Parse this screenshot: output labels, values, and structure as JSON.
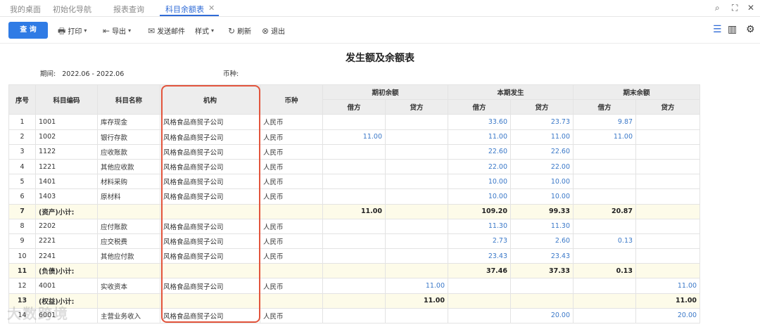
{
  "tabs": [
    {
      "label": "我的桌面"
    },
    {
      "label": "初始化导航"
    },
    {
      "label": "报表查询"
    },
    {
      "label": "科目余额表"
    }
  ],
  "toolbar": {
    "query_label": "查 询",
    "print_label": "打印",
    "export_label": "导出",
    "email_label": "发送邮件",
    "style_label": "样式",
    "refresh_label": "刷新",
    "exit_label": "退出"
  },
  "report": {
    "title": "发生额及余额表",
    "period_label": "期间:",
    "period_value": "2022.06 - 2022.06",
    "currency_label": "币种:"
  },
  "columns": {
    "seq": "序号",
    "code": "科目编码",
    "name": "科目名称",
    "org": "机构",
    "currency": "币种",
    "opening": "期初余额",
    "current": "本期发生",
    "closing": "期末余额",
    "debit": "借方",
    "credit": "贷方"
  },
  "rows": [
    {
      "seq": "1",
      "code": "1001",
      "name": "库存现金",
      "org": "风格食品商贸子公司",
      "cur": "人民币",
      "od": "",
      "oc": "",
      "cd": "33.60",
      "cc": "23.73",
      "ed": "9.87",
      "ec": ""
    },
    {
      "seq": "2",
      "code": "1002",
      "name": "银行存款",
      "org": "风格食品商贸子公司",
      "cur": "人民币",
      "od": "11.00",
      "oc": "",
      "cd": "11.00",
      "cc": "11.00",
      "ed": "11.00",
      "ec": ""
    },
    {
      "seq": "3",
      "code": "1122",
      "name": "应收账款",
      "org": "风格食品商贸子公司",
      "cur": "人民币",
      "od": "",
      "oc": "",
      "cd": "22.60",
      "cc": "22.60",
      "ed": "",
      "ec": ""
    },
    {
      "seq": "4",
      "code": "1221",
      "name": "其他应收款",
      "org": "风格食品商贸子公司",
      "cur": "人民币",
      "od": "",
      "oc": "",
      "cd": "22.00",
      "cc": "22.00",
      "ed": "",
      "ec": ""
    },
    {
      "seq": "5",
      "code": "1401",
      "name": "材料采购",
      "org": "风格食品商贸子公司",
      "cur": "人民币",
      "od": "",
      "oc": "",
      "cd": "10.00",
      "cc": "10.00",
      "ed": "",
      "ec": ""
    },
    {
      "seq": "6",
      "code": "1403",
      "name": "原材料",
      "org": "风格食品商贸子公司",
      "cur": "人民币",
      "od": "",
      "oc": "",
      "cd": "10.00",
      "cc": "10.00",
      "ed": "",
      "ec": ""
    },
    {
      "seq": "7",
      "code": "(资产)小计:",
      "name": "",
      "org": "",
      "cur": "",
      "od": "11.00",
      "oc": "",
      "cd": "109.20",
      "cc": "99.33",
      "ed": "20.87",
      "ec": "",
      "subtotal": true
    },
    {
      "seq": "8",
      "code": "2202",
      "name": "应付账款",
      "org": "风格食品商贸子公司",
      "cur": "人民币",
      "od": "",
      "oc": "",
      "cd": "11.30",
      "cc": "11.30",
      "ed": "",
      "ec": ""
    },
    {
      "seq": "9",
      "code": "2221",
      "name": "应交税费",
      "org": "风格食品商贸子公司",
      "cur": "人民币",
      "od": "",
      "oc": "",
      "cd": "2.73",
      "cc": "2.60",
      "ed": "0.13",
      "ec": ""
    },
    {
      "seq": "10",
      "code": "2241",
      "name": "其他应付款",
      "org": "风格食品商贸子公司",
      "cur": "人民币",
      "od": "",
      "oc": "",
      "cd": "23.43",
      "cc": "23.43",
      "ed": "",
      "ec": ""
    },
    {
      "seq": "11",
      "code": "(负债)小计:",
      "name": "",
      "org": "",
      "cur": "",
      "od": "",
      "oc": "",
      "cd": "37.46",
      "cc": "37.33",
      "ed": "0.13",
      "ec": "",
      "subtotal": true
    },
    {
      "seq": "12",
      "code": "4001",
      "name": "实收资本",
      "org": "风格食品商贸子公司",
      "cur": "人民币",
      "od": "",
      "oc": "11.00",
      "cd": "",
      "cc": "",
      "ed": "",
      "ec": "11.00"
    },
    {
      "seq": "13",
      "code": "(权益)小计:",
      "name": "",
      "org": "",
      "cur": "",
      "od": "",
      "oc": "11.00",
      "cd": "",
      "cc": "",
      "ed": "",
      "ec": "11.00",
      "subtotal": true
    },
    {
      "seq": "14",
      "code": "6001",
      "name": "主营业务收入",
      "org": "风格食品商贸子公司",
      "cur": "人民币",
      "od": "",
      "oc": "",
      "cd": "",
      "cc": "20.00",
      "ed": "",
      "ec": "20.00"
    }
  ],
  "watermark": "大数跨境"
}
